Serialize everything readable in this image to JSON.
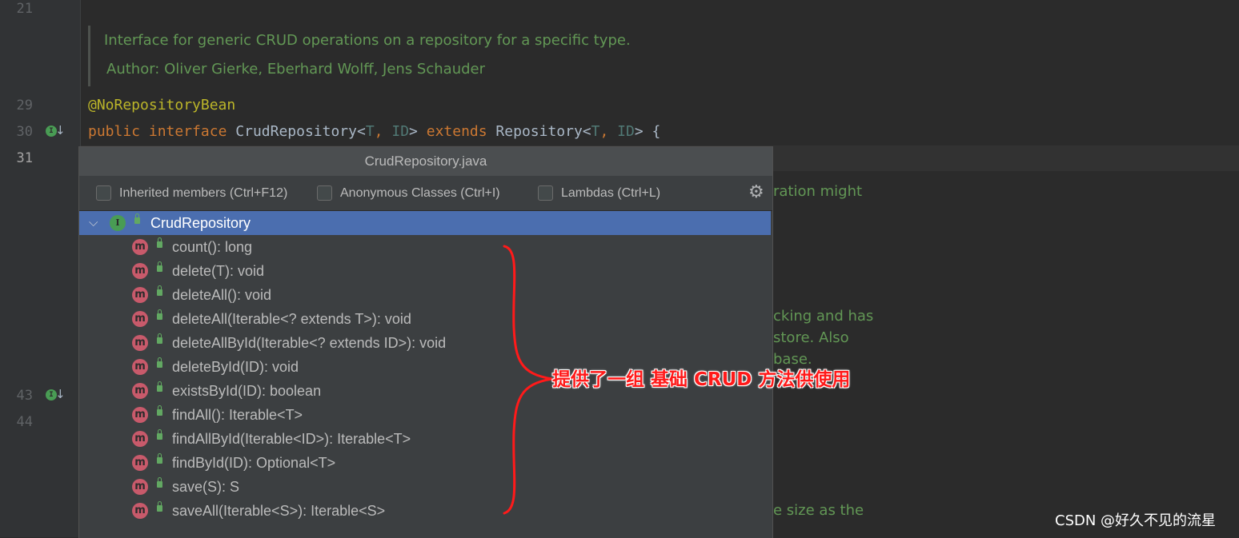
{
  "editor": {
    "line_numbers": [
      {
        "n": "21"
      },
      {
        "n": "29"
      },
      {
        "n": "30"
      },
      {
        "n": "31"
      },
      {
        "n": "43"
      },
      {
        "n": "44"
      }
    ],
    "doc_comment": {
      "summary": "Interface for generic CRUD operations on a repository for a specific type.",
      "author": "Author: Oliver Gierke, Eberhard Wolff, Jens Schauder"
    },
    "code": {
      "annotation": "@NoRepositoryBean",
      "kw_public": "public",
      "kw_interface": "interface",
      "name": "CrudRepository<",
      "t1": "T",
      "comma1": ", ",
      "id1": "ID",
      "close1": "> ",
      "kw_extends": "extends",
      "parent": " Repository<",
      "t2": "T",
      "comma2": ", ",
      "id2": "ID",
      "close2": "> {"
    },
    "background_fragments": {
      "f1": "ration might",
      "f2": "cking and has",
      "f3": "store. Also",
      "f4": "base.",
      "f5": "e size as the"
    }
  },
  "structure_popup": {
    "title": "CrudRepository.java",
    "options": [
      {
        "label": "Inherited members (Ctrl+F12)",
        "checked": false
      },
      {
        "label": "Anonymous Classes (Ctrl+I)",
        "checked": false
      },
      {
        "label": "Lambdas (Ctrl+L)",
        "checked": false
      }
    ],
    "settings_icon": "gear-icon",
    "root": {
      "label": "CrudRepository",
      "icon": "interface-icon",
      "expanded": true
    },
    "methods": [
      {
        "label": "count(): long"
      },
      {
        "label": "delete(T): void"
      },
      {
        "label": "deleteAll(): void"
      },
      {
        "label": "deleteAll(Iterable<? extends T>): void"
      },
      {
        "label": "deleteAllById(Iterable<? extends ID>): void"
      },
      {
        "label": "deleteById(ID): void"
      },
      {
        "label": "existsById(ID): boolean"
      },
      {
        "label": "findAll(): Iterable<T>"
      },
      {
        "label": "findAllById(Iterable<ID>): Iterable<T>"
      },
      {
        "label": "findById(ID): Optional<T>"
      },
      {
        "label": "save(S): S"
      },
      {
        "label": "saveAll(Iterable<S>): Iterable<S>"
      }
    ]
  },
  "annotation_overlay": {
    "callout": "提供了一组 基础 CRUD 方法供使用",
    "color": "#ff1a1a"
  },
  "watermark": "CSDN @好久不见的流星",
  "colors": {
    "editor_bg": "#2b2b2b",
    "popup_bg": "#3c3f41",
    "selection": "#4b6eaf",
    "doc_comment": "#629755",
    "keyword": "#cc7832",
    "annotation": "#bbb529"
  }
}
